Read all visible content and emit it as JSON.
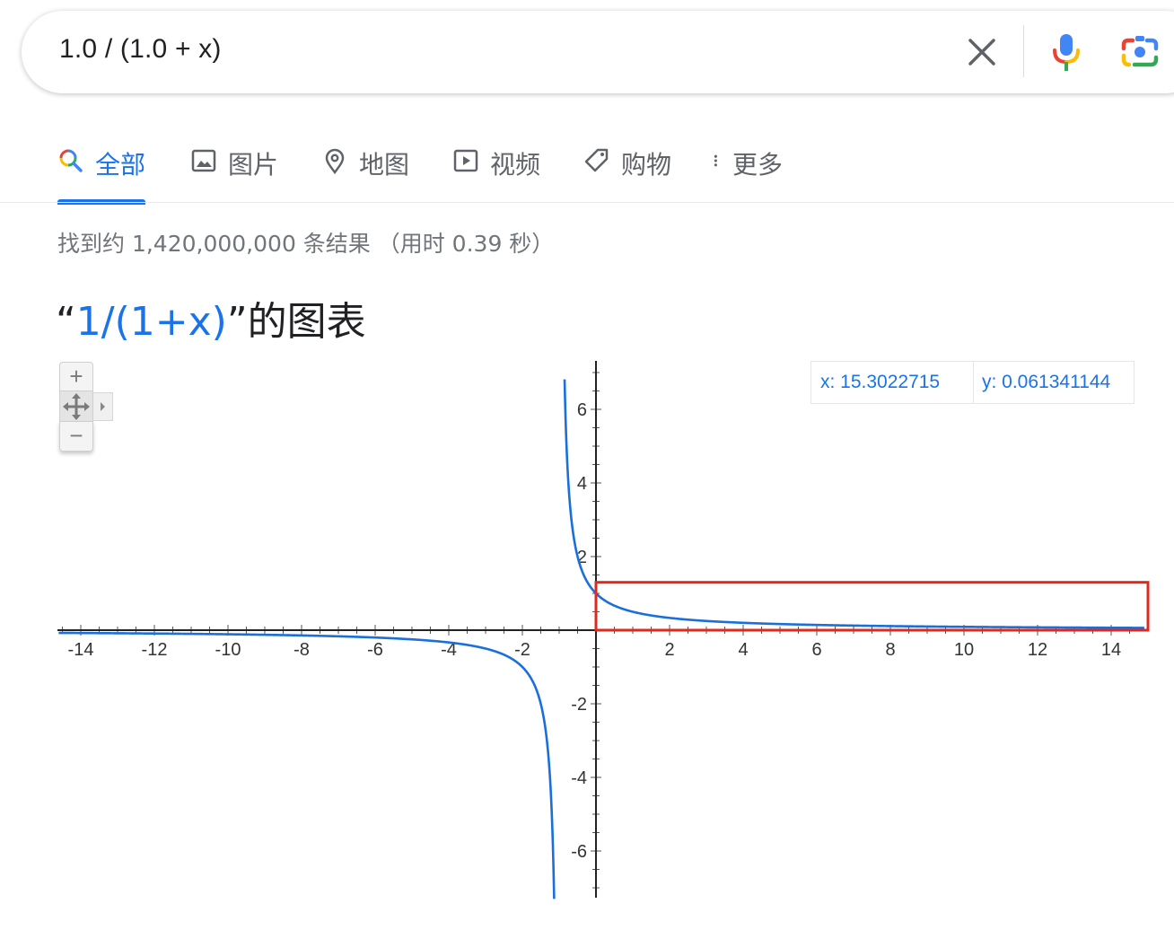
{
  "search": {
    "query": "1.0 / (1.0 + x)",
    "clear_icon": "close-icon",
    "mic_icon": "mic-icon",
    "camera_icon": "camera-lens-icon"
  },
  "tabs": [
    {
      "label": "全部",
      "icon": "search-icon",
      "active": true
    },
    {
      "label": "图片",
      "icon": "image-icon",
      "active": false
    },
    {
      "label": "地图",
      "icon": "map-pin-icon",
      "active": false
    },
    {
      "label": "视频",
      "icon": "play-icon",
      "active": false
    },
    {
      "label": "购物",
      "icon": "tag-icon",
      "active": false
    },
    {
      "label": "更多",
      "icon": "more-vert-icon",
      "active": false
    }
  ],
  "result_stats": "找到约 1,420,000,000 条结果 （用时 0.39 秒）",
  "graph": {
    "title_open": "“",
    "title_function": "1/(1+x)",
    "title_close": "”的图表",
    "zoom": {
      "in_label": "+",
      "out_label": "−"
    },
    "readout": {
      "x": "x: 15.3022715",
      "y": "y: 0.061341144"
    },
    "colors": {
      "curve": "#1a6fdb",
      "highlight_box": "#e0281e",
      "accent": "#1a73e8"
    }
  },
  "chart_data": {
    "type": "line",
    "function": "1/(1+x)",
    "xlim": [
      -14.6,
      14.9
    ],
    "ylim": [
      -7.2,
      7.3
    ],
    "x_ticks": [
      -14,
      -12,
      -10,
      -8,
      -6,
      -4,
      -2,
      2,
      4,
      6,
      8,
      10,
      12,
      14
    ],
    "y_ticks": [
      -6,
      -4,
      -2,
      2,
      4,
      6
    ],
    "series": [
      {
        "values_fn": "1/(1+x)",
        "asymptote_x": -1
      }
    ],
    "highlight_region": {
      "x": [
        0,
        15.0
      ],
      "y": [
        0,
        1.3
      ]
    }
  }
}
